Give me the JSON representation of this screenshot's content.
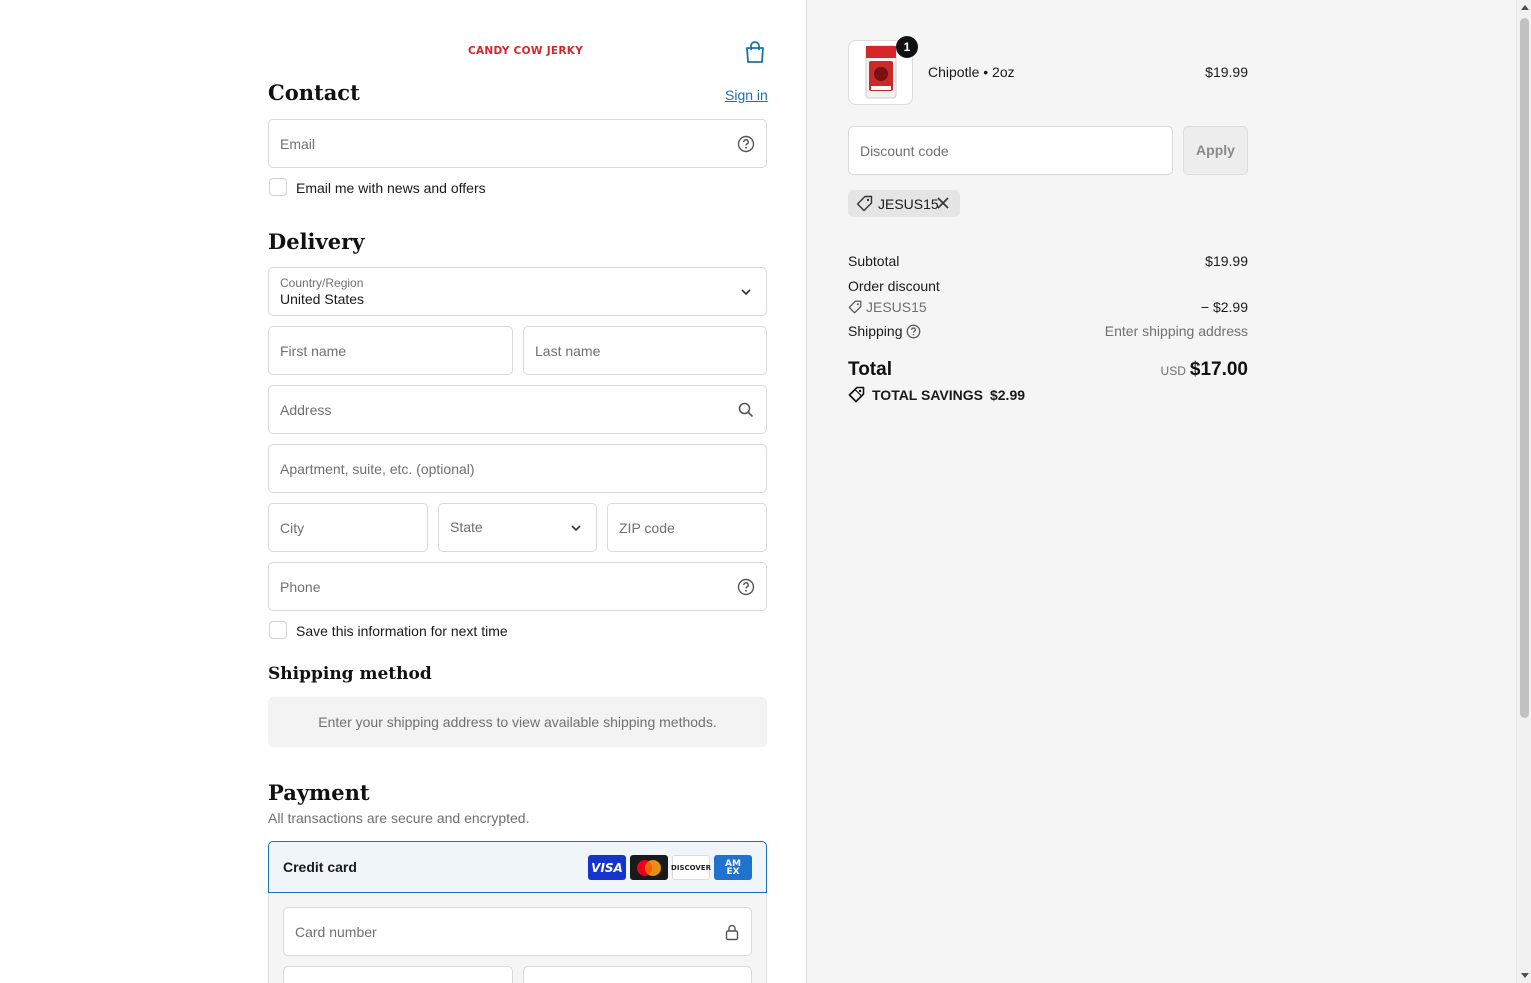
{
  "brand": {
    "logo_text": "CANDY COW JERKY",
    "logo_color": "#d7262b"
  },
  "contact": {
    "heading": "Contact",
    "signin": "Sign in",
    "email_placeholder": "Email",
    "news_checkbox_label": "Email me with news and offers"
  },
  "delivery": {
    "heading": "Delivery",
    "country_label": "Country/Region",
    "country_value": "United States",
    "first_name": "First name",
    "last_name": "Last name",
    "address": "Address",
    "apartment": "Apartment, suite, etc. (optional)",
    "city": "City",
    "state": "State",
    "zip": "ZIP code",
    "phone": "Phone",
    "save_checkbox_label": "Save this information for next time"
  },
  "shipping_method": {
    "heading": "Shipping method",
    "message": "Enter your shipping address to view available shipping methods."
  },
  "payment": {
    "heading": "Payment",
    "subtext": "All transactions are secure and encrypted.",
    "credit_card_label": "Credit card",
    "cards": {
      "visa": "VISA",
      "discover": "DISCOVER",
      "amex_top": "AM",
      "amex_bottom": "EX"
    },
    "card_number": "Card number"
  },
  "order": {
    "quantity": "1",
    "product_name": "Chipotle • 2oz",
    "product_price": "$19.99",
    "discount_placeholder": "Discount code",
    "apply": "Apply",
    "applied_code": "JESUS15",
    "subtotal_label": "Subtotal",
    "subtotal_value": "$19.99",
    "order_discount_label": "Order discount",
    "discount_code": "JESUS15",
    "discount_value": "− $2.99",
    "shipping_label": "Shipping",
    "shipping_value": "Enter shipping address",
    "total_label": "Total",
    "total_currency": "USD",
    "total_value": "$17.00",
    "savings_label": "TOTAL SAVINGS",
    "savings_value": "$2.99"
  },
  "colors": {
    "link": "#1773b0",
    "accent_border": "#1773b0",
    "summary_bg": "#f5f5f5"
  }
}
